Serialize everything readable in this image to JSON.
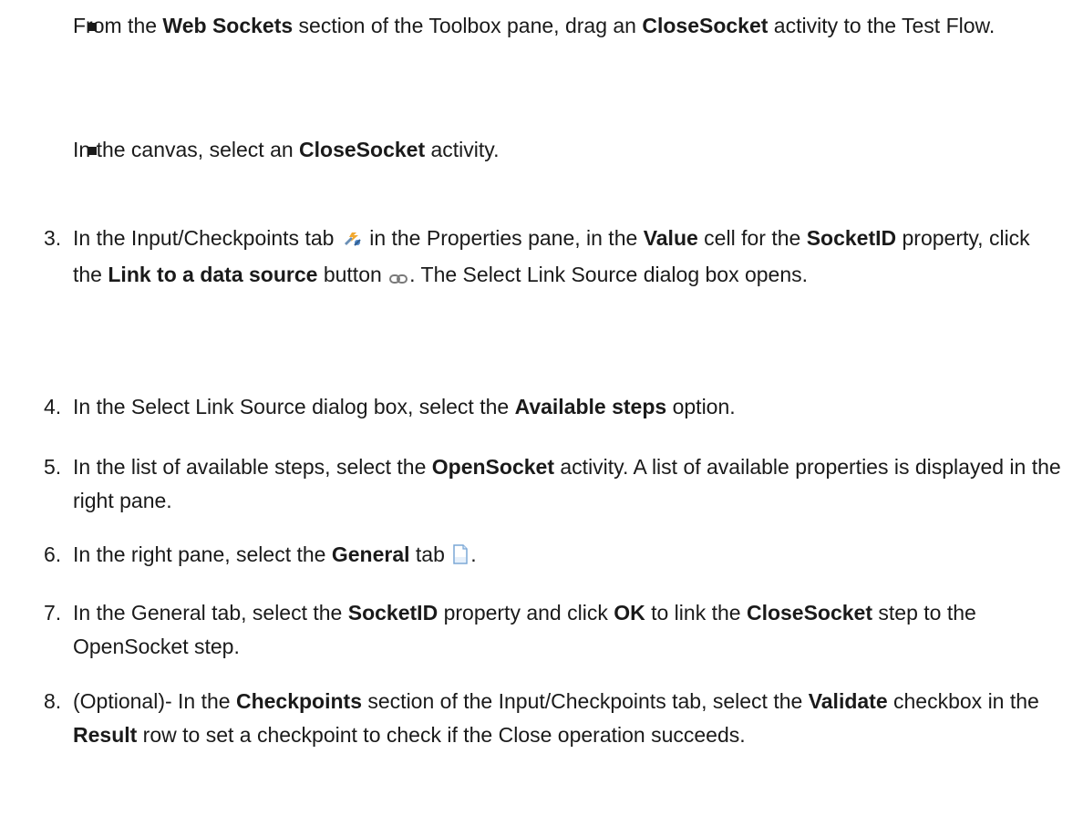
{
  "bullets": [
    {
      "t0": "From the ",
      "b0": "Web Sockets",
      "t1": " section of the Toolbox pane, drag an ",
      "b1": "CloseSocket",
      "t2": " activity to the Test Flow."
    },
    {
      "t0": "In the canvas, select an ",
      "b0": "CloseSocket",
      "t1": " activity."
    }
  ],
  "steps": [
    {
      "num": "3.",
      "t0": "In the Input/Checkpoints tab ",
      "icon0": "input-checkpoints-icon",
      "t1": " in the Properties pane, in the ",
      "b0": "Value",
      "t2": " cell for the ",
      "b1": "SocketID",
      "t3": " property, click the ",
      "b2": "Link to a data source",
      "t4": " button ",
      "icon1": "link-icon",
      "t5": ". The Select Link Source dialog box opens."
    },
    {
      "num": "4.",
      "t0": "In the Select Link Source dialog box, select the ",
      "b0": "Available steps",
      "t1": " option."
    },
    {
      "num": "5.",
      "t0": "In the list of available steps, select the ",
      "b0": "OpenSocket",
      "t1": " activity. A list of available properties is displayed in the right pane."
    },
    {
      "num": "6.",
      "t0": "In the right pane, select the ",
      "b0": "General",
      "t1": " tab ",
      "icon0": "general-tab-icon",
      "t2": "."
    },
    {
      "num": "7.",
      "t0": "In the General tab, select the ",
      "b0": "SocketID",
      "t1": " property and click ",
      "b1": "OK",
      "t2": " to link the ",
      "b2": "CloseSocket",
      "t3": " step to the OpenSocket step."
    },
    {
      "num": "8.",
      "t0": "(Optional)- In the ",
      "b0": "Checkpoints",
      "t1": " section of the Input/Checkpoints tab, select the ",
      "b1": "Validate",
      "t2": " checkbox in the ",
      "b2": "Result",
      "t3": " row to set a checkpoint to check if the Close operation succeeds."
    }
  ]
}
